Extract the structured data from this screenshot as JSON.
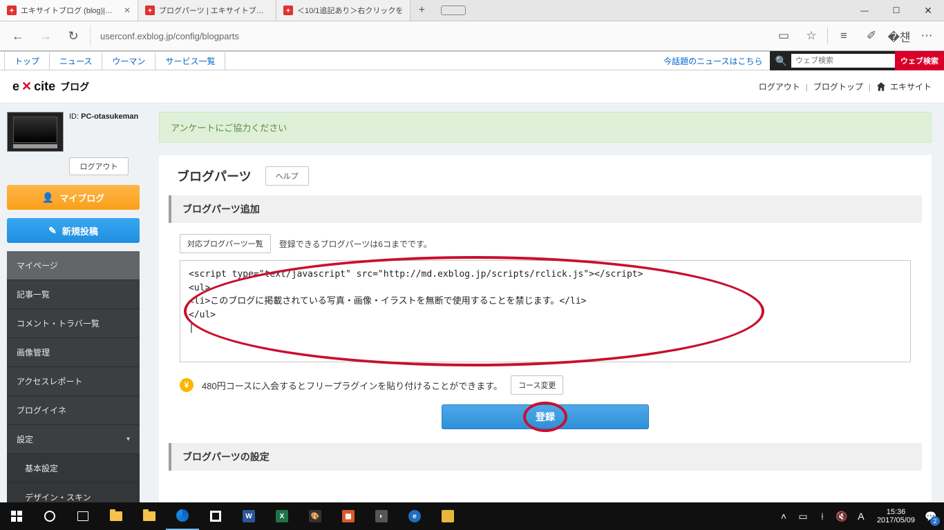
{
  "browser": {
    "tabs": [
      {
        "label": "エキサイトブログ (blog)|ブロ",
        "active": true
      },
      {
        "label": "ブログパーツ | エキサイトブログ",
        "active": false
      },
      {
        "label": "＜10/1追記あり＞右クリックを",
        "active": false
      }
    ],
    "url": "userconf.exblog.jp/config/blogparts"
  },
  "window": {
    "min": "—",
    "max": "☐",
    "close": "✕"
  },
  "site_nav": {
    "items": [
      "トップ",
      "ニュース",
      "ウーマン",
      "サービス一覧"
    ],
    "promo": "今話題のニュースはこちら",
    "search_placeholder": "ウェブ検索",
    "search_btn": "ウェブ検索"
  },
  "header": {
    "logo_brand_pre": "e",
    "logo_brand_x": "✕",
    "logo_brand_post": "cite",
    "logo_sub": "ブログ",
    "links": {
      "logout": "ログアウト",
      "blogtop": "ブログトップ",
      "excite": "エキサイト"
    }
  },
  "sidebar": {
    "id_label": "ID:",
    "username": "PC-otasukeman",
    "logout": "ログアウト",
    "myblog": "マイブログ",
    "newpost": "新規投稿",
    "nav": [
      "マイページ",
      "記事一覧",
      "コメント・トラバ一覧",
      "画像管理",
      "アクセスレポート",
      "ブログイイネ"
    ],
    "settings": "設定",
    "subnav": [
      "基本設定",
      "デザイン・スキン"
    ]
  },
  "main": {
    "notice": "アンケートにご協力ください",
    "title": "ブログパーツ",
    "help": "ヘルプ",
    "section_add": "ブログパーツ追加",
    "compat_btn": "対応ブログパーツ一覧",
    "limit_note": "登録できるブログパーツは6コまでです。",
    "textarea": "<script type=\"text/javascript\" src=\"http://md.exblog.jp/scripts/rclick.js\"></script>\n<ul>\n<li>このブログに掲載されている写真・画像・イラストを無断で使用することを禁じます。</li>\n</ul>\n|",
    "upsell": "480円コースに入会するとフリープラグインを貼り付けることができます。",
    "course_btn": "コース変更",
    "submit": "登録",
    "section_config": "ブログパーツの設定"
  },
  "taskbar": {
    "time": "15:36",
    "date": "2017/05/09",
    "ime": "A",
    "badge": "2"
  }
}
